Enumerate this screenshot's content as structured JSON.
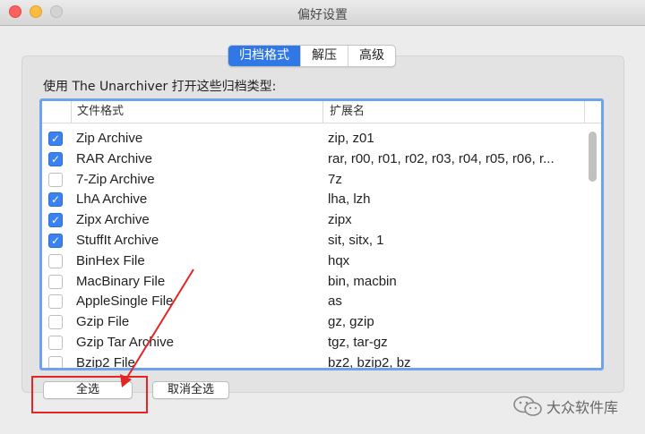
{
  "window": {
    "title": "偏好设置"
  },
  "tabs": [
    {
      "label": "归档格式",
      "active": true
    },
    {
      "label": "解压",
      "active": false
    },
    {
      "label": "高级",
      "active": false
    }
  ],
  "prompt": "使用 The Unarchiver 打开这些归档类型:",
  "table": {
    "headers": {
      "format": "文件格式",
      "extensions": "扩展名"
    },
    "rows": [
      {
        "format": "Zip Archive",
        "extensions": "zip, z01",
        "checked": true
      },
      {
        "format": "RAR Archive",
        "extensions": "rar, r00, r01, r02, r03, r04, r05, r06, r...",
        "checked": true
      },
      {
        "format": "7-Zip Archive",
        "extensions": "7z",
        "checked": false
      },
      {
        "format": "LhA Archive",
        "extensions": "lha, lzh",
        "checked": true
      },
      {
        "format": "Zipx Archive",
        "extensions": "zipx",
        "checked": true
      },
      {
        "format": "StuffIt Archive",
        "extensions": "sit, sitx, 1",
        "checked": true
      },
      {
        "format": "BinHex File",
        "extensions": "hqx",
        "checked": false
      },
      {
        "format": "MacBinary File",
        "extensions": "bin, macbin",
        "checked": false
      },
      {
        "format": "AppleSingle File",
        "extensions": "as",
        "checked": false
      },
      {
        "format": "Gzip File",
        "extensions": "gz, gzip",
        "checked": false
      },
      {
        "format": "Gzip Tar Archive",
        "extensions": "tgz, tar-gz",
        "checked": false
      },
      {
        "format": "Bzip2 File",
        "extensions": "bz2, bzip2, bz",
        "checked": false
      }
    ]
  },
  "buttons": {
    "select_all": "全选",
    "deselect_all": "取消全选"
  },
  "watermark": "大众软件库",
  "colors": {
    "accent": "#2f78e5",
    "annotation": "#e42525"
  }
}
